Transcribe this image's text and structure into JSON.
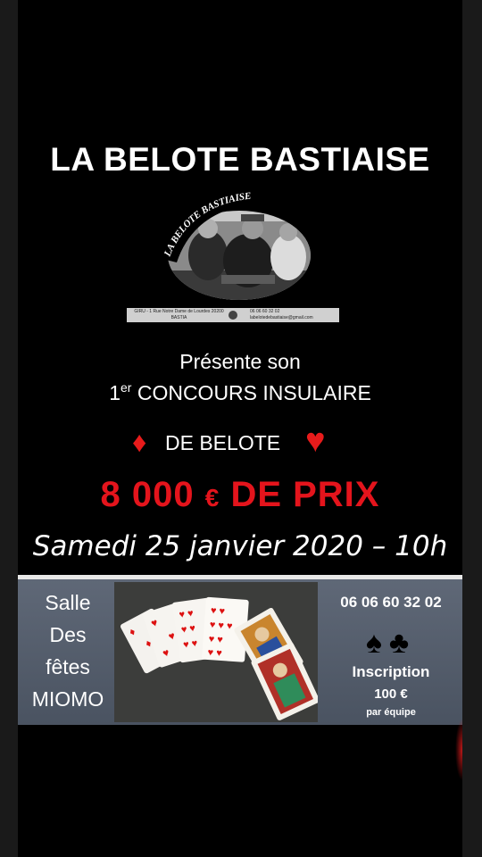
{
  "title": "LA BELOTE BASTIAISE",
  "logo": {
    "arc_text": "LA BELOTE BASTIAISE",
    "address": "GIRU - 1 Rue Notre Dame de Lourdes 20200 BASTIA",
    "contact": "06 06 60 32 02 labelotedebastiaise@gmail.com"
  },
  "presents": "Présente son",
  "contest_ordinal": "1",
  "contest_ordinal_suffix": "er",
  "contest_name": "CONCOURS INSULAIRE",
  "contest_subtitle": "DE BELOTE",
  "prize_amount": "8 000",
  "prize_currency": "€",
  "prize_label": "DE PRIX",
  "date": "Samedi 25 janvier 2020 – 10h",
  "venue": [
    "Salle",
    "Des",
    "fêtes",
    "MIOMO"
  ],
  "phone": "06  06 60 32 02",
  "inscription_label": "Inscription",
  "inscription_price": "100 €",
  "inscription_per": "par équipe",
  "colors": {
    "accent_red": "#e4141c",
    "panel": "#545d6b",
    "background": "#000000"
  }
}
